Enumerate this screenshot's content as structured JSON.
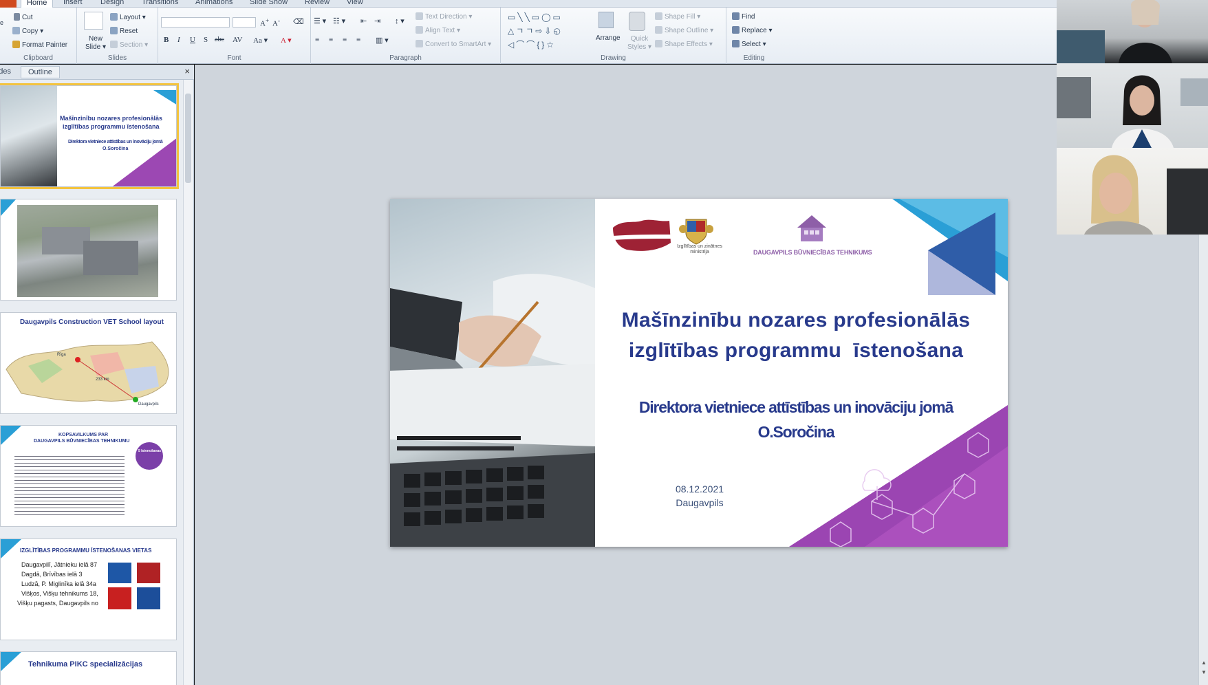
{
  "ribbon": {
    "tabs": [
      "Home",
      "Insert",
      "Design",
      "Transitions",
      "Animations",
      "Slide Show",
      "Review",
      "View"
    ],
    "active_tab": "Home",
    "clipboard": {
      "cut": "Cut",
      "copy": "Copy",
      "format_painter": "Format Painter",
      "label": "Clipboard"
    },
    "slides": {
      "new_slide": "New",
      "new_slide_2": "Slide",
      "layout": "Layout",
      "reset": "Reset",
      "section": "Section",
      "label": "Slides"
    },
    "font": {
      "label": "Font",
      "bold": "B",
      "italic": "I",
      "underline": "U",
      "strike": "S",
      "abc": "abc"
    },
    "paragraph": {
      "text_direction": "Text Direction",
      "align_text": "Align Text",
      "convert_smartart": "Convert to SmartArt",
      "label": "Paragraph"
    },
    "drawing": {
      "arrange": "Arrange",
      "quick_styles": "Quick",
      "quick_styles_2": "Styles",
      "shape_fill": "Shape Fill",
      "shape_outline": "Shape Outline",
      "shape_effects": "Shape Effects",
      "label": "Drawing"
    },
    "editing": {
      "find": "Find",
      "replace": "Replace",
      "select": "Select",
      "label": "Editing"
    }
  },
  "pane": {
    "tabs": [
      "Slides",
      "Outline"
    ],
    "close": "×",
    "thumbnails": {
      "t1_title1": "Mašīnzinību nozares profesionālās",
      "t1_title2": "izglītības programmu īstenošana",
      "t1_sub": "Direktora vietniece attīstības un inovāciju jomā",
      "t1_name": "O.Soročina",
      "t3_title": "Daugavpils Construction VET School layout",
      "t3_riga": "Rīga",
      "t3_dist": "233 km",
      "t3_daug": "Daugavpils",
      "t4_title1": "KOPSAVILKUMS PAR",
      "t4_title2": "DAUGAVPILS BŪVNIECĪBAS TEHNIKUMU",
      "t4_badge": "5 īstenošanas vietas",
      "t5_title": "IZGLĪTĪBAS PROGRAMMU ĪSTENOŠANAS VIETAS",
      "t5_items": [
        "Daugavpilī, Jātnieku ielā 87",
        "Dagdā, Brīvības ielā 3",
        "Ludzā, P. Miglinīka ielā 34a",
        "Višķos, Višķu tehnikums 18,",
        "Višķu pagasts, Daugavpils no"
      ],
      "t6_title": "Tehnikuma PIKC specializācijas"
    }
  },
  "slide": {
    "title_line1": "Mašīnzinību nozares profesionālās",
    "title_line2": "izglītības programmu  īstenošana",
    "subtitle_line1": "Direktora vietniece attīstības un inovāciju jomā",
    "subtitle_line2": "O.Soročina",
    "date": "08.12.2021",
    "place": "Daugavpils",
    "ministry_caption_1": "Izglītības un zinātnes",
    "ministry_caption_2": "ministrija",
    "school_logo_text": "DAUGAVPILS BŪVNIECĪBAS TEHNIKUMS"
  },
  "colors": {
    "title": "#283a8c",
    "accent_blue": "#2a9fd6",
    "accent_purple": "#8e3fa6",
    "school_purple": "#8e5fa8"
  },
  "video_tiles": 3
}
